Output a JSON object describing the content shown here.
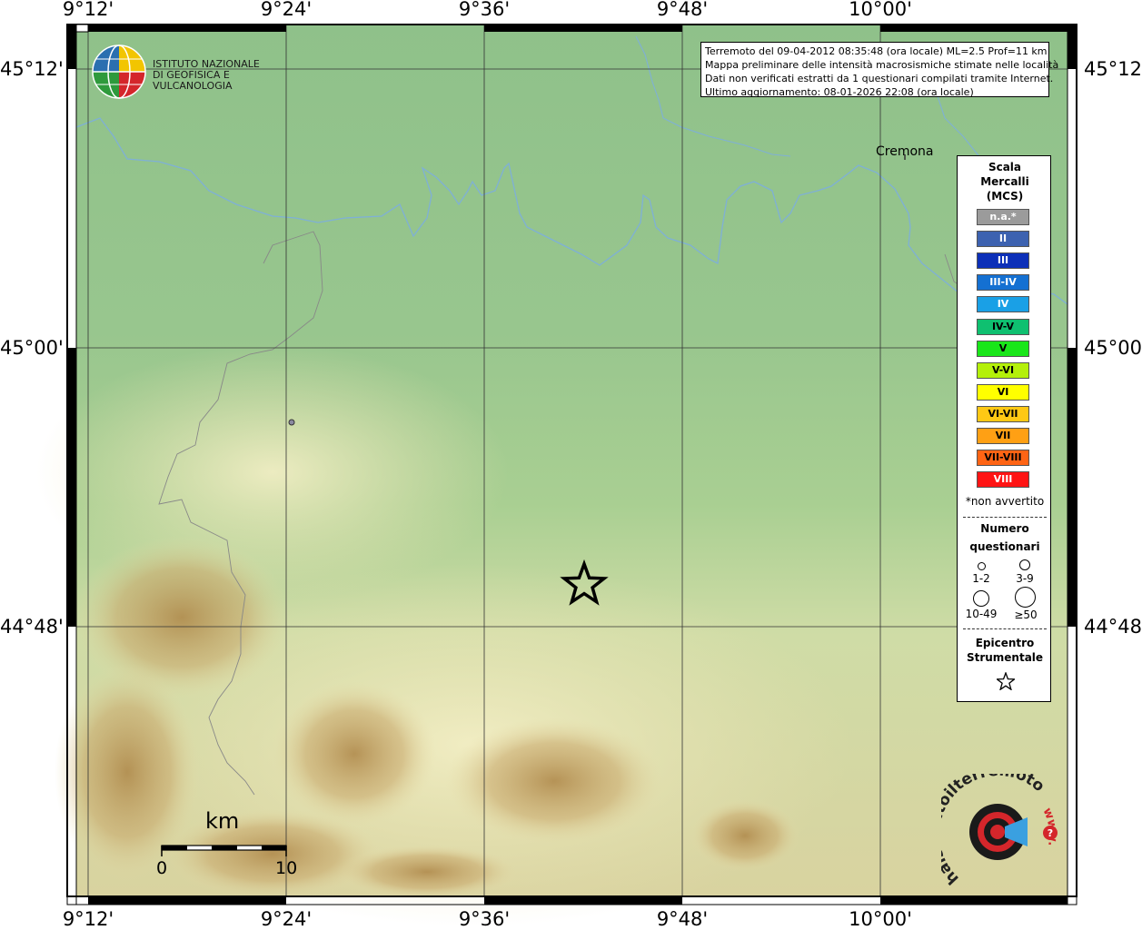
{
  "map": {
    "lon_ticks": [
      "9°12'",
      "9°24'",
      "9°36'",
      "9°48'",
      "10°00'"
    ],
    "lat_ticks": [
      "45°12'",
      "45°00'",
      "44°48'"
    ],
    "city": "Cremona",
    "epicenter_symbol": "star-icon"
  },
  "logo": {
    "line1": "ISTITUTO NAZIONALE",
    "line2": "DI GEOFISICA E VULCANOLOGIA"
  },
  "info": {
    "line1": "Terremoto del 09-04-2012 08:35:48 (ora locale) ML=2.5 Prof=11 km",
    "line2": "Mappa preliminare delle intensità macrosismiche stimate nelle località",
    "line3": "Dati non verificati estratti da 1 questionari compilati tramite Internet.",
    "line4": "Ultimo aggiornamento: 08-01-2026 22:08 (ora locale)"
  },
  "legend": {
    "title1": "Scala",
    "title2": "Mercalli",
    "title3": "(MCS)",
    "classes": [
      {
        "label": "n.a.*",
        "color": "#9b9b9b",
        "text_color": "#ffffff"
      },
      {
        "label": "II",
        "color": "#3d62b0",
        "text_color": "#ffffff"
      },
      {
        "label": "III",
        "color": "#0c2fb8",
        "text_color": "#ffffff"
      },
      {
        "label": "III-IV",
        "color": "#1470d2",
        "text_color": "#ffffff"
      },
      {
        "label": "IV",
        "color": "#1aa0e6",
        "text_color": "#ffffff"
      },
      {
        "label": "IV-V",
        "color": "#0fc070",
        "text_color": "#000000"
      },
      {
        "label": "V",
        "color": "#19e619",
        "text_color": "#000000"
      },
      {
        "label": "V-VI",
        "color": "#b4f00a",
        "text_color": "#000000"
      },
      {
        "label": "VI",
        "color": "#ffff00",
        "text_color": "#000000"
      },
      {
        "label": "VI-VII",
        "color": "#ffc814",
        "text_color": "#000000"
      },
      {
        "label": "VII",
        "color": "#ffa014",
        "text_color": "#000000"
      },
      {
        "label": "VII-VIII",
        "color": "#ff6414",
        "text_color": "#000000"
      },
      {
        "label": "VIII",
        "color": "#ff1414",
        "text_color": "#ffffff"
      }
    ],
    "note": "*non avvertito",
    "count_title1": "Numero",
    "count_title2": "questionari",
    "count_1": "1-2",
    "count_2": "3-9",
    "count_3": "10-49",
    "count_4": "≥50",
    "epi_title1": "Epicentro",
    "epi_title2": "Strumentale"
  },
  "scalebar": {
    "title": "km",
    "min": "0",
    "max": "10"
  },
  "site_logo": {
    "text": "haisentitoilterremoto.it",
    "url_text": "www."
  }
}
